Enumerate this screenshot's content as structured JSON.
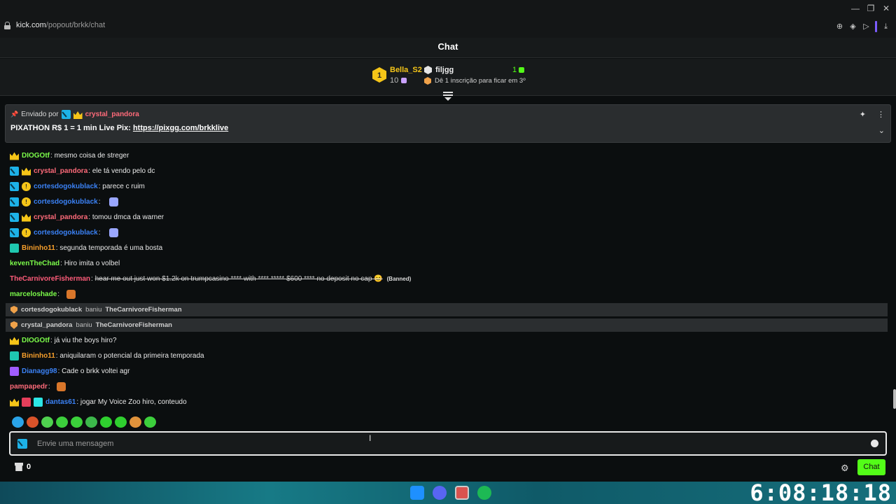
{
  "browser": {
    "url_host": "kick.com",
    "url_path": "/popout/brkk/chat"
  },
  "chat": {
    "title": "Chat"
  },
  "leaderboard": {
    "first": {
      "rank": "1",
      "name": "Bella_S2",
      "count": "10"
    },
    "second": {
      "name": "filjgg",
      "count": "1"
    },
    "hint": "Dê 1 inscrição para ficar em 3º"
  },
  "pinned": {
    "sent_by": "Enviado por",
    "author": "crystal_pandora",
    "message_prefix": "PIXATHON R$ 1 = 1 min Live Pix: ",
    "link": "https://pixgg.com/brkklive"
  },
  "messages": [
    {
      "badges": [
        "crown"
      ],
      "user": "DIOGOtf",
      "color": "#7cfc4a",
      "text": "mesmo coisa de streger"
    },
    {
      "badges": [
        "mod",
        "crown"
      ],
      "user": "crystal_pandora",
      "color": "#ff6b7a",
      "text": "ele tá vendo pelo dc"
    },
    {
      "badges": [
        "mod",
        "og"
      ],
      "user": "cortesdogokublack",
      "color": "#3b82f6",
      "text": "parece c ruim"
    },
    {
      "badges": [
        "mod",
        "og"
      ],
      "user": "cortesdogokublack",
      "color": "#3b82f6",
      "text": "",
      "emote": "gc"
    },
    {
      "badges": [
        "mod",
        "crown"
      ],
      "user": "crystal_pandora",
      "color": "#ff6b7a",
      "text": "tomou dmca da warner"
    },
    {
      "badges": [
        "mod",
        "og"
      ],
      "user": "cortesdogokublack",
      "color": "#3b82f6",
      "text": "",
      "emote": "gc"
    },
    {
      "badges": [
        "vip"
      ],
      "user": "Bininho11",
      "color": "#f59e2b",
      "text": "segunda temporada é uma bosta"
    },
    {
      "badges": [],
      "user": "kevenTheChad",
      "color": "#7cfc4a",
      "text": "Hiro imita o volbel"
    },
    {
      "badges": [],
      "user": "TheCarnivoreFisherman",
      "color": "#ff5c7a",
      "text": "hear me out just won $1.2k on trumpcasino **** with **** ***** $600 **** no deposit no cap 😊",
      "strike": true,
      "banned": "(Banned)"
    },
    {
      "badges": [],
      "user": "marceloshade",
      "color": "#7cfc4a",
      "text": "",
      "emote": "kai"
    },
    {
      "badges": [
        "crown"
      ],
      "user": "DIOGOtf",
      "color": "#7cfc4a",
      "text": "já viu the boys hiro?"
    },
    {
      "badges": [
        "vip"
      ],
      "user": "Bininho11",
      "color": "#f59e2b",
      "text": "aniquilaram o potencial da primeira temporada"
    },
    {
      "badges": [
        "sub"
      ],
      "user": "Dianagg98",
      "color": "#3b82f6",
      "text": "Cade o brkk voltei agr"
    },
    {
      "badges": [],
      "user": "pampapedr",
      "color": "#ff6b7a",
      "text": "",
      "emote": "kai"
    },
    {
      "badges": [
        "crown",
        "red",
        "gift"
      ],
      "user": "dantas61",
      "color": "#3b82f6",
      "text": "jogar My Voice Zoo hiro, conteudo"
    }
  ],
  "system": [
    {
      "mod": "cortesdogokublack",
      "action": "baniu",
      "target": "TheCarnivoreFisherman"
    },
    {
      "mod": "crystal_pandora",
      "action": "baniu",
      "target": "TheCarnivoreFisherman"
    }
  ],
  "emote_bar": [
    "#2aa3e8",
    "#d9532a",
    "#4fd14f",
    "#3ccf3c",
    "#3bd13b",
    "#3cb84b",
    "#2fcf2f",
    "#2fcf2f",
    "#e0923b",
    "#3ccf3c"
  ],
  "input": {
    "placeholder": "Envie uma mensagem"
  },
  "footer": {
    "points": "0",
    "send_label": "Chat"
  },
  "taskbar": {
    "clock": "6:08:18:18"
  }
}
